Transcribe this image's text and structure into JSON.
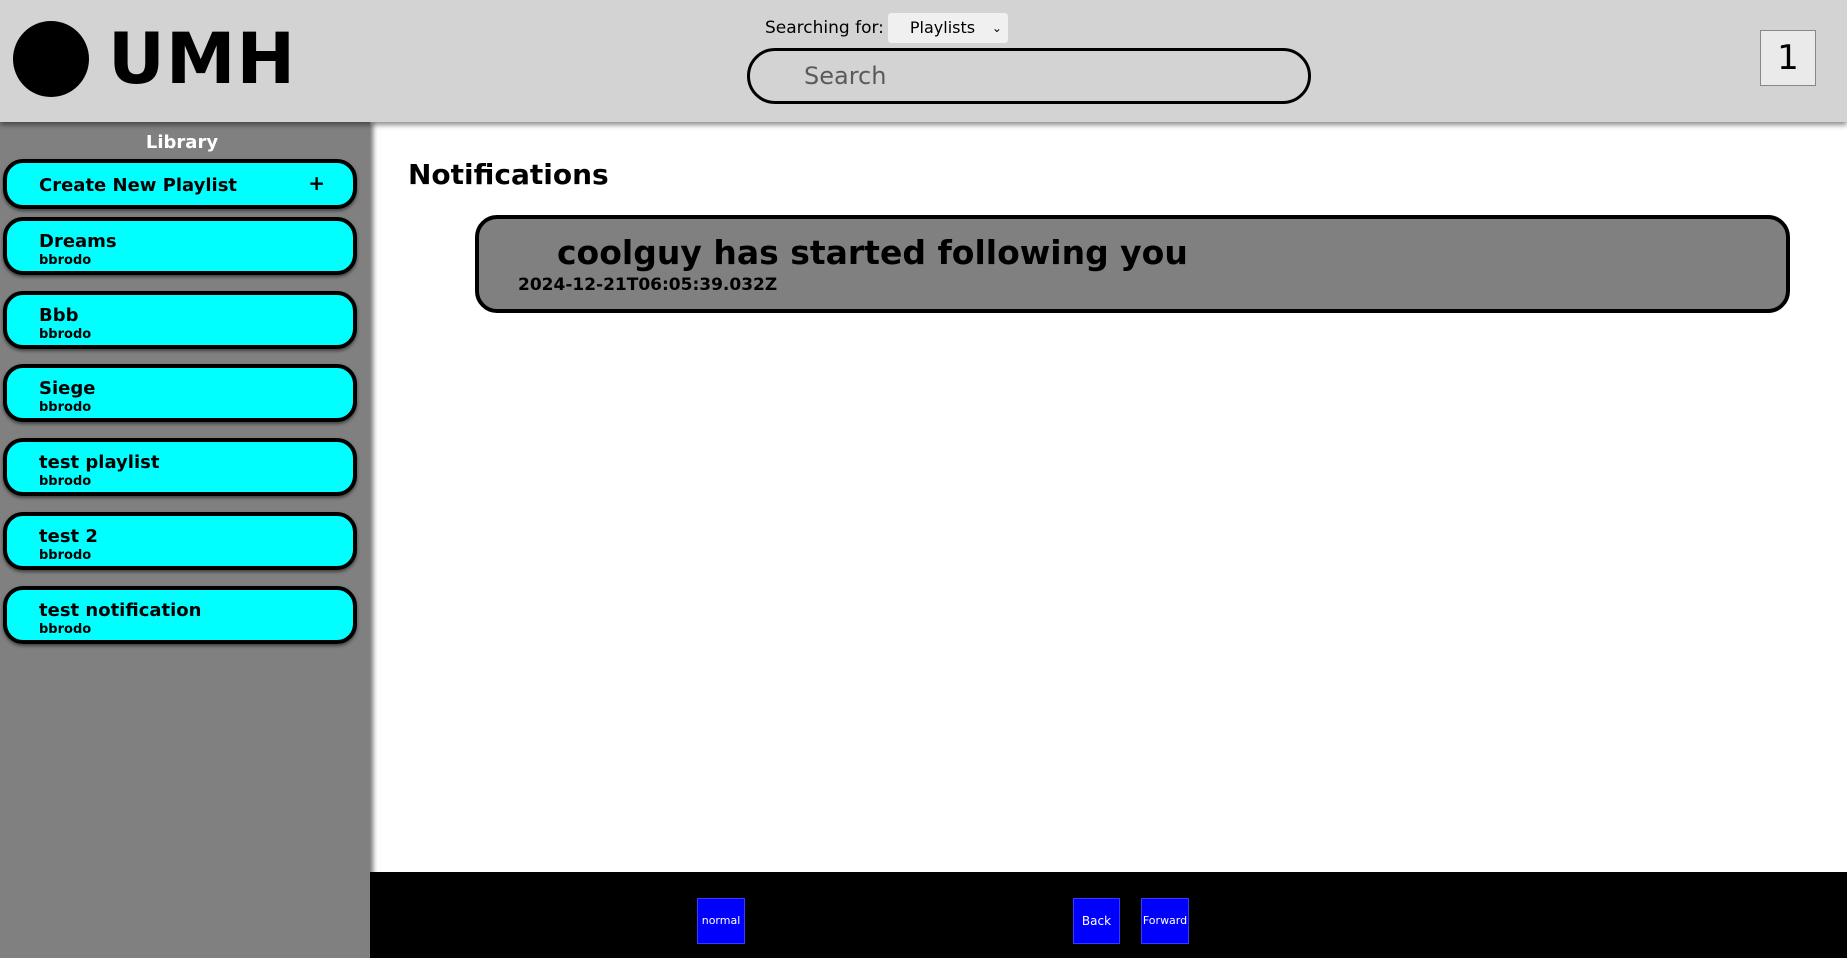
{
  "header": {
    "logo_text": "UMH",
    "search_for_label": "Searching for:",
    "search_type_selected": "Playlists",
    "search_placeholder": "Search",
    "badge_count": "1"
  },
  "sidebar": {
    "title": "Library",
    "create_label": "Create New Playlist",
    "create_icon": "+",
    "playlists": [
      {
        "name": "Dreams",
        "owner": "bbrodo"
      },
      {
        "name": "Bbb",
        "owner": "bbrodo"
      },
      {
        "name": "Siege",
        "owner": "bbrodo"
      },
      {
        "name": "test playlist",
        "owner": "bbrodo"
      },
      {
        "name": "test 2",
        "owner": "bbrodo"
      },
      {
        "name": "test notification",
        "owner": "bbrodo"
      }
    ]
  },
  "main": {
    "title": "Notifications",
    "notifications": [
      {
        "message": "coolguy has started following you",
        "timestamp": "2024-12-21T06:05:39.032Z"
      }
    ]
  },
  "footer": {
    "mode_label": "normal",
    "back_label": "Back",
    "forward_label": "Forward"
  },
  "colors": {
    "header_bg": "#d3d3d3",
    "sidebar_bg": "#808080",
    "playlist_card_bg": "#00ffff",
    "notification_bg": "#808080",
    "footer_bg": "#000000",
    "footer_button_bg": "#0000ff"
  }
}
